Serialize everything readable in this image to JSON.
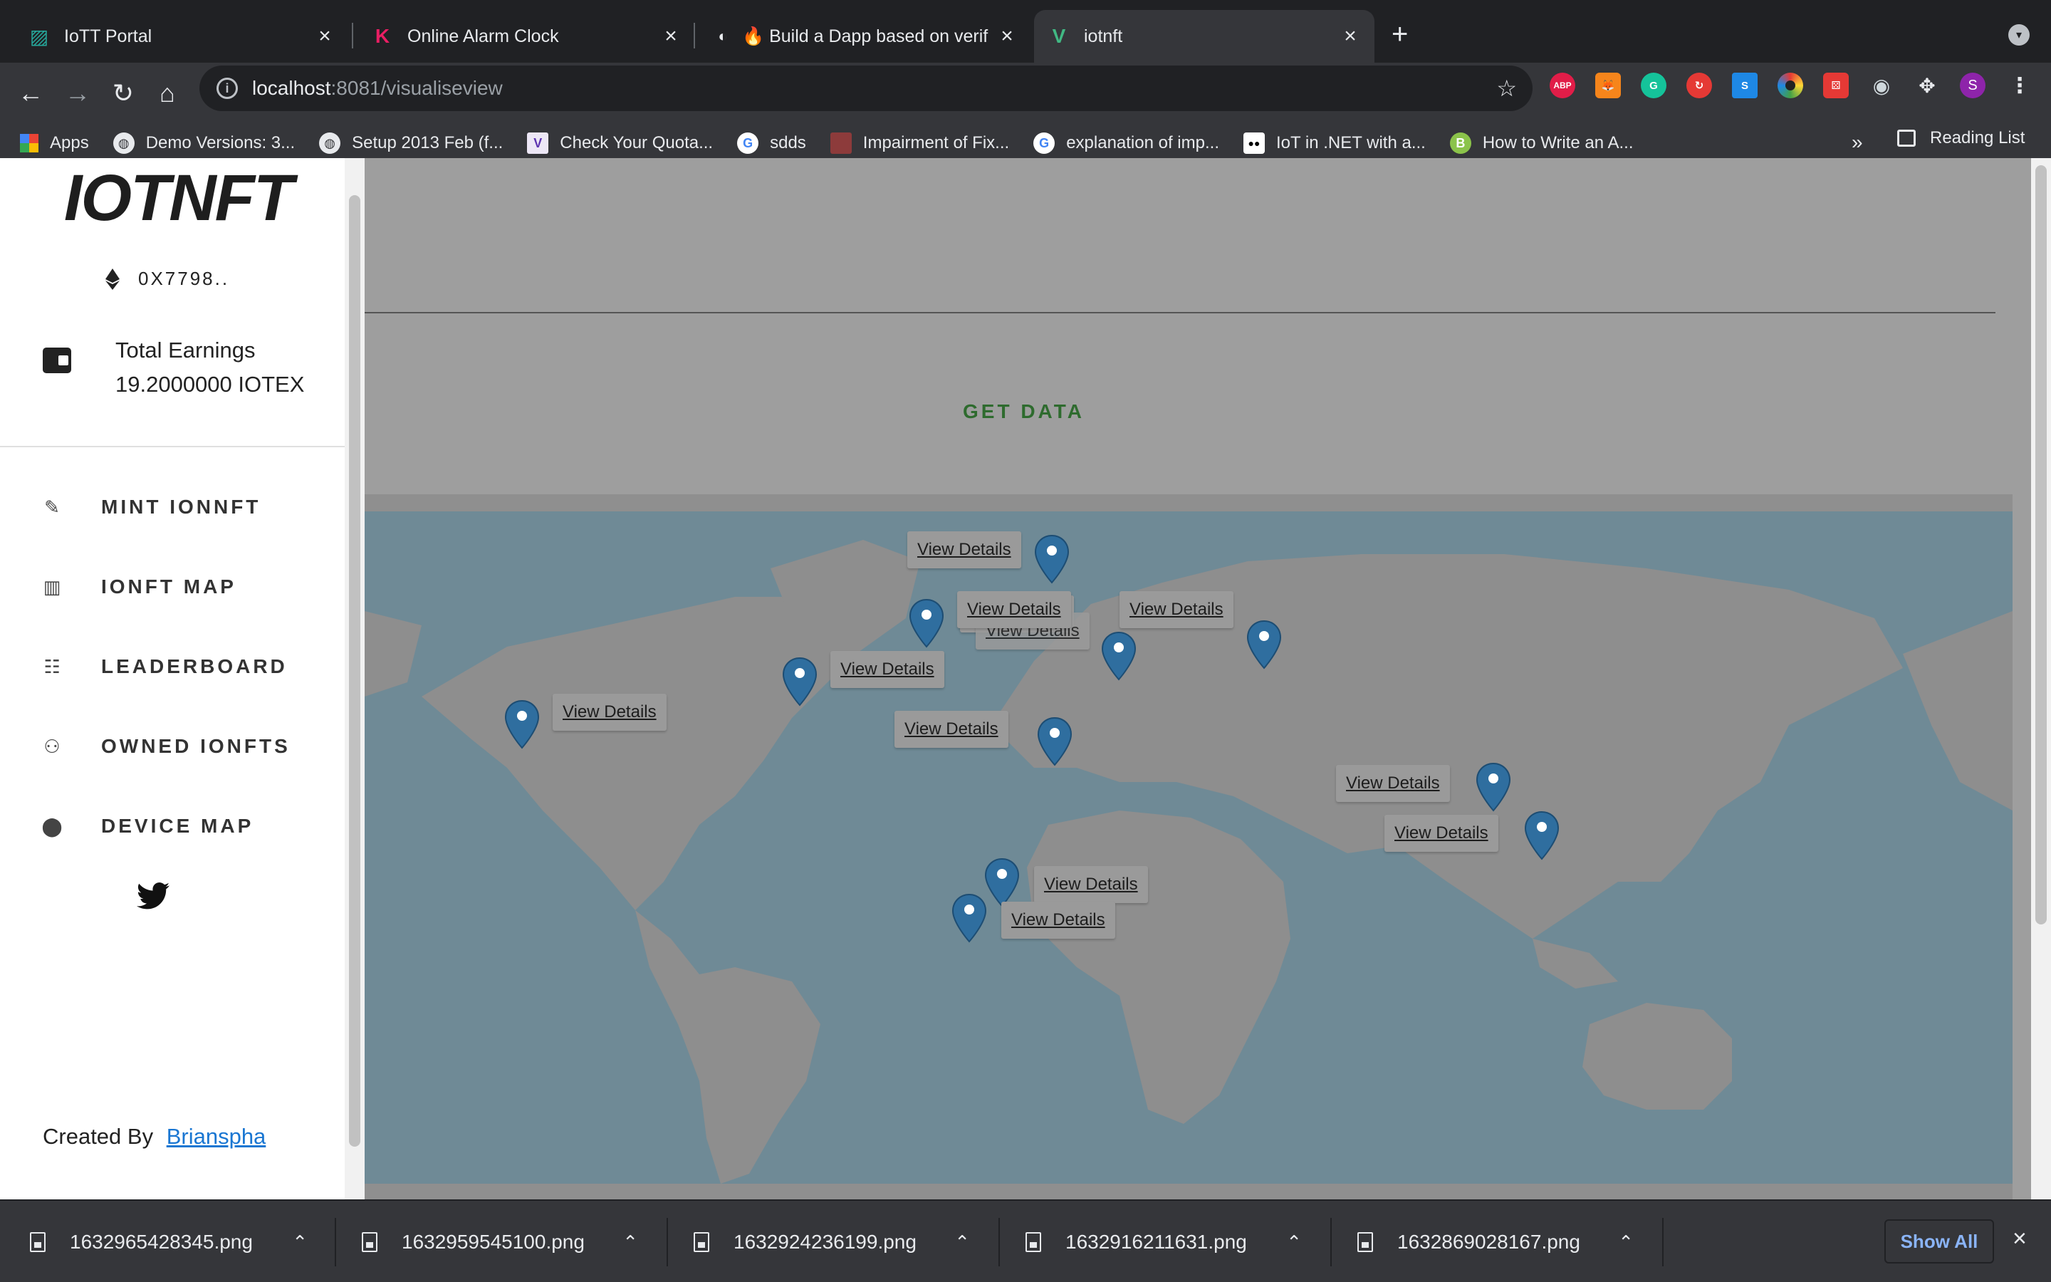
{
  "tabs": [
    {
      "title": "IoTT Portal",
      "icon": "iott-portal-icon",
      "active": false
    },
    {
      "title": "Online Alarm Clock",
      "icon": "k-logo-icon",
      "active": false
    },
    {
      "title": "🔥 Build a Dapp based on verif",
      "icon": "github-logo-icon",
      "active": false
    },
    {
      "title": "iotnft",
      "icon": "vue-logo-icon",
      "active": true
    }
  ],
  "toolbar": {
    "url_host": "localhost",
    "url_path": ":8081/visualiseview"
  },
  "extensions": [
    {
      "name": "adblock-icon",
      "label": "ABP",
      "color": "#e11d48"
    },
    {
      "name": "metamask-icon",
      "label": "",
      "color": "#f6851b"
    },
    {
      "name": "grammarly-icon",
      "label": "G",
      "color": "#15c39a"
    },
    {
      "name": "sync-icon",
      "label": "",
      "color": "#e53935"
    },
    {
      "name": "s-extension-icon",
      "label": "S",
      "color": "#1e88e5"
    },
    {
      "name": "color-picker-icon",
      "label": "",
      "color": "#43a047"
    },
    {
      "name": "dice-icon",
      "label": "",
      "color": "#e53935"
    },
    {
      "name": "github-icon",
      "label": "",
      "color": "#cfd8dc"
    },
    {
      "name": "puzzle-icon",
      "label": "",
      "color": "#e8eaed"
    },
    {
      "name": "profile-avatar-icon",
      "label": "S",
      "color": "#8e24aa"
    }
  ],
  "bookmarks": [
    {
      "label": "Apps",
      "icon": "apps-grid-icon"
    },
    {
      "label": "Demo Versions: 3...",
      "icon": "globe-icon"
    },
    {
      "label": "Setup 2013 Feb (f...",
      "icon": "globe-icon"
    },
    {
      "label": "Check Your Quota...",
      "icon": "v-badge-icon"
    },
    {
      "label": "sdds",
      "icon": "google-icon"
    },
    {
      "label": "Impairment of Fix...",
      "icon": "book-icon"
    },
    {
      "label": "explanation of imp...",
      "icon": "google-icon"
    },
    {
      "label": "IoT in .NET with a...",
      "icon": "medium-icon"
    },
    {
      "label": "How to Write an A...",
      "icon": "blog-icon"
    }
  ],
  "bookmarks_more": "»",
  "reading_list": "Reading List",
  "sidebar": {
    "logo": "IOTNFT",
    "wallet": "0X7798..",
    "earnings_label": "Total Earnings",
    "earnings_value": "19.2000000 IOTEX",
    "nav": [
      {
        "label": "MINT IONNFT",
        "icon": "pencil-icon"
      },
      {
        "label": "IONFT MAP",
        "icon": "map-icon"
      },
      {
        "label": "LEADERBOARD",
        "icon": "ladder-icon"
      },
      {
        "label": "OWNED IONFTS",
        "icon": "person-check-icon"
      },
      {
        "label": "DEVICE MAP",
        "icon": "location-pin-icon"
      }
    ],
    "created_by": "Created By",
    "author": "Brianspha"
  },
  "main": {
    "get_data": "GET DATA",
    "popup_label": "View Details"
  },
  "downloads": [
    "1632965428345.png",
    "1632959545100.png",
    "1632924236199.png",
    "1632916211631.png",
    "1632869028167.png"
  ],
  "show_all": "Show All"
}
